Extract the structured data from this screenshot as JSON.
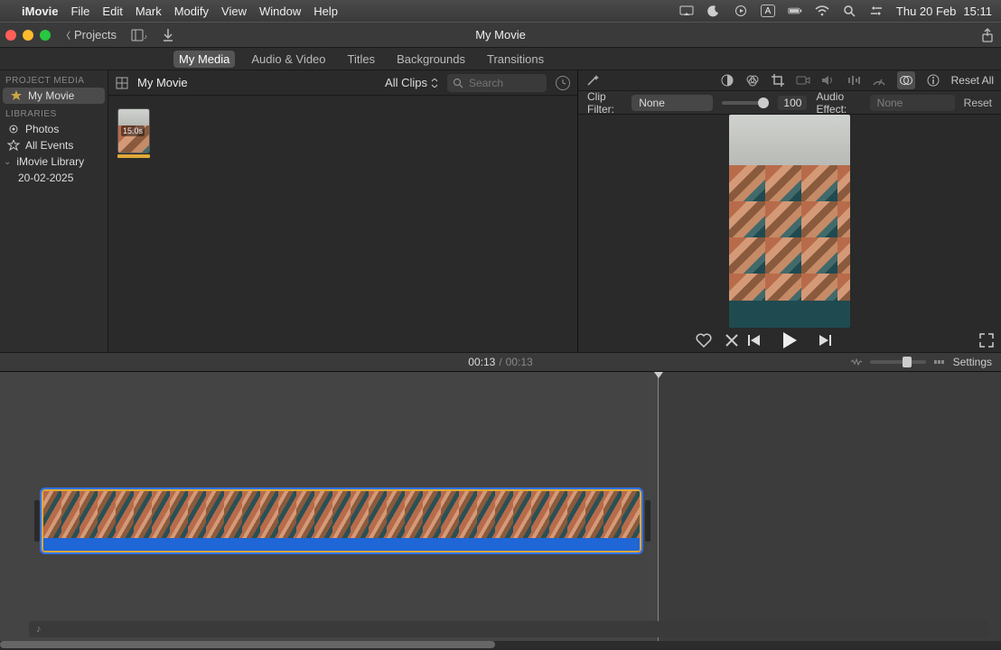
{
  "menubar": {
    "app": "iMovie",
    "items": [
      "File",
      "Edit",
      "Mark",
      "Modify",
      "View",
      "Window",
      "Help"
    ],
    "date": "Thu 20 Feb",
    "time": "15:11",
    "icon_a": "A"
  },
  "projbar": {
    "back": "Projects",
    "title": "My Movie"
  },
  "tabs": [
    "My Media",
    "Audio & Video",
    "Titles",
    "Backgrounds",
    "Transitions"
  ],
  "active_tab": 0,
  "sidebar": {
    "hdr1": "PROJECT MEDIA",
    "proj": "My Movie",
    "hdr2": "LIBRARIES",
    "photos": "Photos",
    "allevents": "All Events",
    "library": "iMovie Library",
    "date": "20-02-2025"
  },
  "browser": {
    "title": "My Movie",
    "filter": "All Clips",
    "search_placeholder": "Search",
    "clip_duration": "15.0s"
  },
  "adjust": {
    "reset_all": "Reset All",
    "clip_filter_label": "Clip Filter:",
    "clip_filter_value": "None",
    "slider_value": "100",
    "audio_effect_label": "Audio Effect:",
    "audio_effect_value": "None",
    "reset": "Reset"
  },
  "transport": {
    "current": "00:13",
    "sep": "/",
    "total": "00:13",
    "settings": "Settings"
  },
  "music_icon": "♪"
}
